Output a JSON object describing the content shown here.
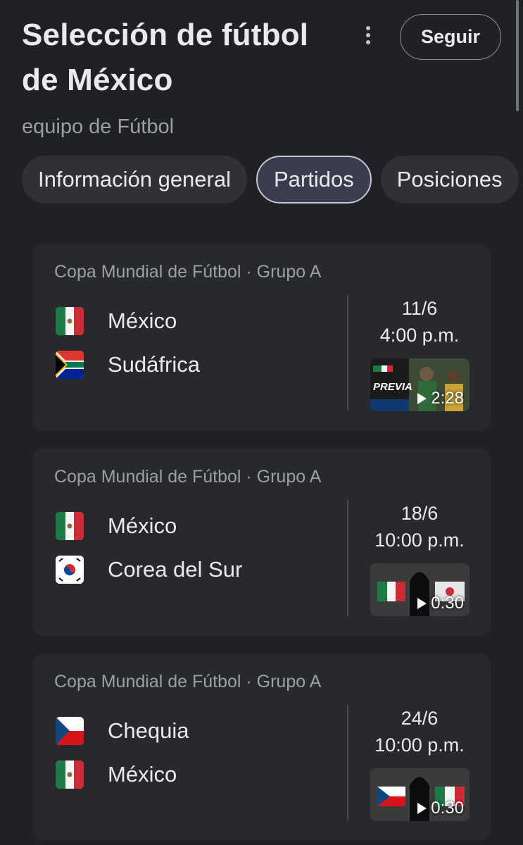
{
  "header": {
    "title": "Selección de fútbol de México",
    "subtitle": "equipo de Fútbol",
    "follow_label": "Seguir",
    "more_icon": "more-vert-icon"
  },
  "tabs": [
    {
      "label": "Información general",
      "active": false
    },
    {
      "label": "Partidos",
      "active": true
    },
    {
      "label": "Posiciones",
      "active": false
    }
  ],
  "matches": [
    {
      "competition": "Copa Mundial de Fútbol · Grupo A",
      "team1": {
        "name": "México",
        "flag": "mexico-flag-icon"
      },
      "team2": {
        "name": "Sudáfrica",
        "flag": "south-africa-flag-icon"
      },
      "date": "11/6",
      "time": "4:00 p.m.",
      "video_duration": "2:28",
      "thumbnail_text": "PREVIA"
    },
    {
      "competition": "Copa Mundial de Fútbol · Grupo A",
      "team1": {
        "name": "México",
        "flag": "mexico-flag-icon"
      },
      "team2": {
        "name": "Corea del Sur",
        "flag": "south-korea-flag-icon"
      },
      "date": "18/6",
      "time": "10:00 p.m.",
      "video_duration": "0:30"
    },
    {
      "competition": "Copa Mundial de Fútbol · Grupo A",
      "team1": {
        "name": "Chequia",
        "flag": "czechia-flag-icon"
      },
      "team2": {
        "name": "México",
        "flag": "mexico-flag-icon"
      },
      "date": "24/6",
      "time": "10:00 p.m.",
      "video_duration": "0:30"
    }
  ],
  "colors": {
    "background": "#202124",
    "card": "#28292c",
    "active_tab": "#3a3d4d"
  }
}
